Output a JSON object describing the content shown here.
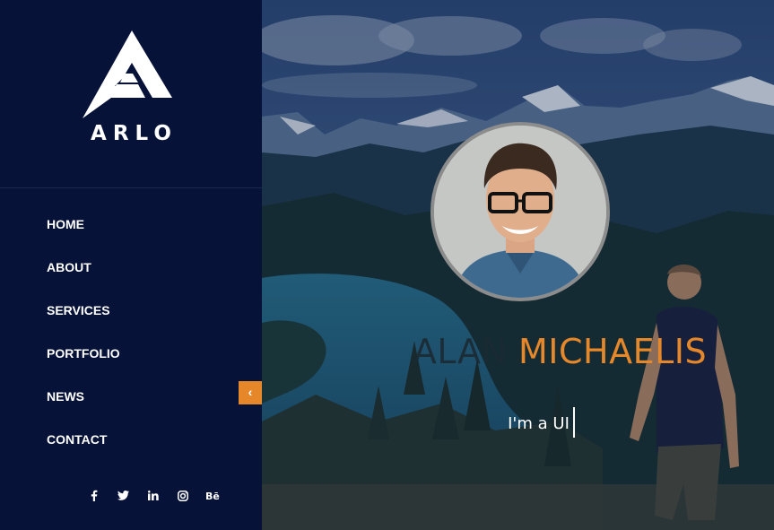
{
  "brand": {
    "name": "ARLO",
    "logo_icon": "arlo-a-logo"
  },
  "nav": {
    "items": [
      {
        "label": "HOME"
      },
      {
        "label": "ABOUT"
      },
      {
        "label": "SERVICES"
      },
      {
        "label": "PORTFOLIO"
      },
      {
        "label": "NEWS"
      },
      {
        "label": "CONTACT"
      }
    ]
  },
  "collapse": {
    "icon": "chevron-left-icon",
    "glyph": "‹"
  },
  "social": {
    "items": [
      {
        "icon": "facebook-icon"
      },
      {
        "icon": "twitter-icon"
      },
      {
        "icon": "linkedin-icon"
      },
      {
        "icon": "instagram-icon"
      },
      {
        "icon": "behance-icon"
      }
    ]
  },
  "hero": {
    "first_name": "ALAN",
    "last_name": "MICHAELIS",
    "tagline": "I'm a  UI",
    "avatar": "profile-photo"
  },
  "colors": {
    "sidebar_bg": "#061237",
    "accent": "#e6882a",
    "text": "#ffffff"
  }
}
